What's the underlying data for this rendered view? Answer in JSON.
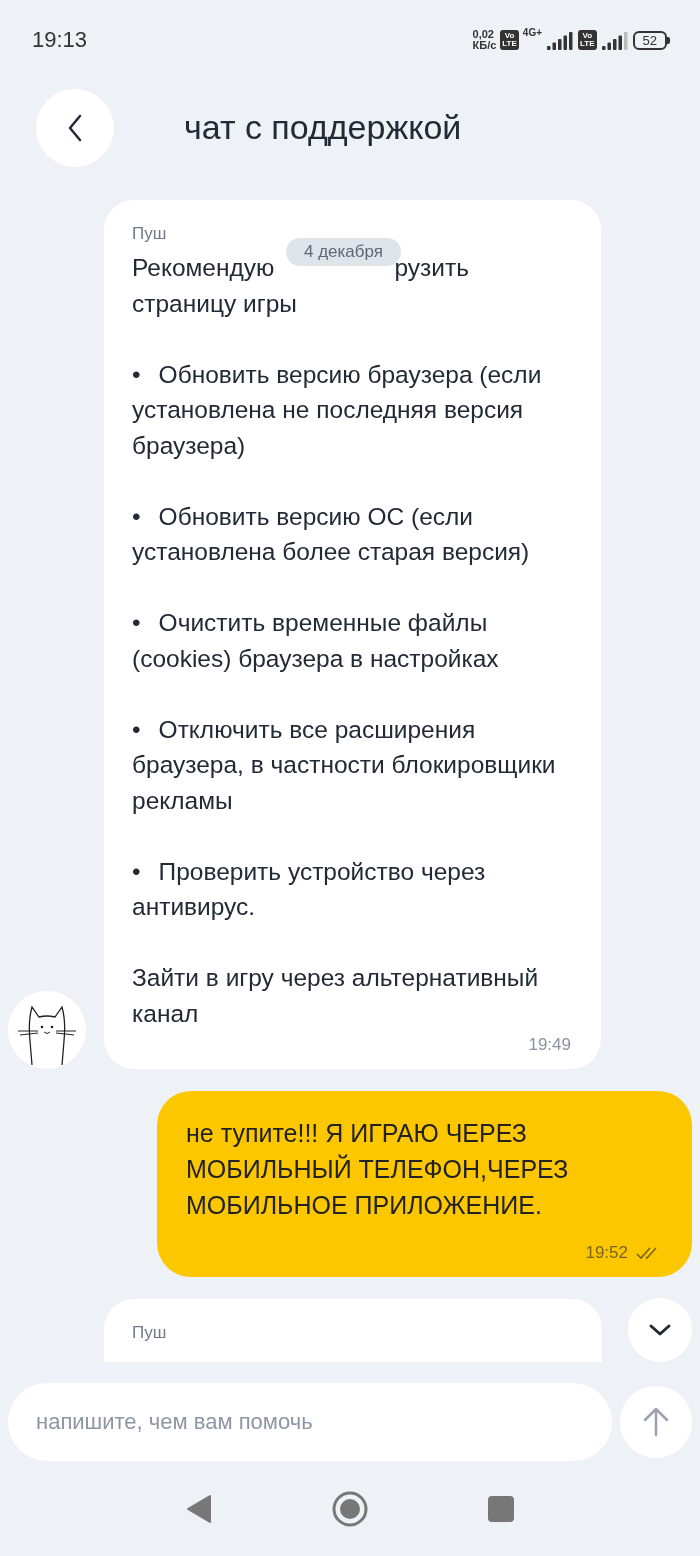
{
  "status_bar": {
    "time": "19:13",
    "speed_value": "0,02",
    "speed_unit": "КБ/с",
    "sim1_badge": [
      "Vo",
      "LTE"
    ],
    "sim1_network": "4G+",
    "sim2_badge": [
      "Vo",
      "LTE"
    ],
    "battery": "52"
  },
  "header": {
    "title": "чат с поддержкой"
  },
  "date_chip": "4 декабря",
  "messages": [
    {
      "kind": "incoming",
      "sender": "Пуш",
      "intro_visible": [
        "Рекомендую",
        "рузить"
      ],
      "intro_rest": "страницу игры",
      "bullets": [
        {
          "mark": "•",
          "text": "Обновить версию браузера (если установлена не последняя версия браузера)"
        },
        {
          "mark": "•",
          "text": "Обновить версию ОС (если установлена более старая версия)"
        },
        {
          "mark": "•",
          "text": "Очистить временные файлы (cookies) браузера в настройках"
        },
        {
          "mark": "•",
          "text": "Отключить все расширения браузера, в частности блокировщики рекламы"
        },
        {
          "mark": "•",
          "text": "Проверить устройство через антивирус."
        }
      ],
      "closing": "Зайти в игру через альтернативный канал",
      "time": "19:49",
      "avatar": true
    },
    {
      "kind": "outgoing",
      "text": "не тупите!!!  Я ИГРАЮ ЧЕРЕЗ МОБИЛЬНЫЙ ТЕЛЕФОН,ЧЕРЕЗ МОБИЛЬНОЕ ПРИЛОЖЕНИЕ.",
      "time": "19:52",
      "read": true
    },
    {
      "kind": "incoming_partial",
      "sender": "Пуш"
    }
  ],
  "composer": {
    "placeholder": "напишите, чем вам помочь"
  }
}
